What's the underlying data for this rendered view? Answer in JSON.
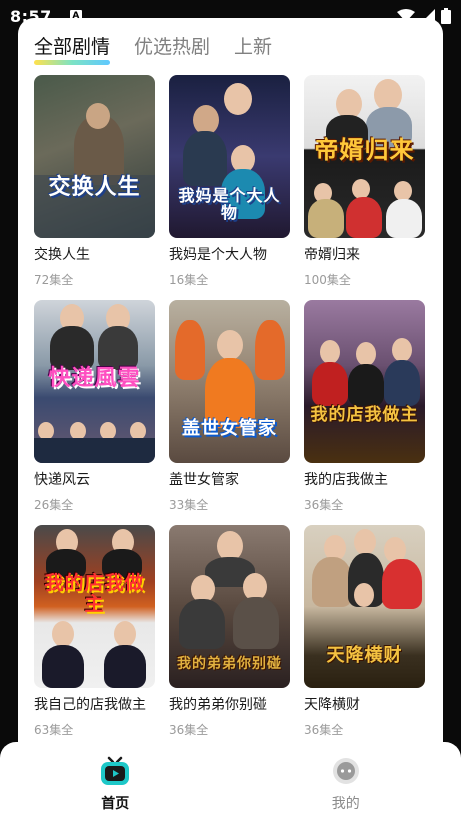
{
  "status_bar": {
    "time": "8:57",
    "notification_badge": "A",
    "icons": [
      "wifi-icon",
      "signal-icon",
      "battery-icon"
    ]
  },
  "tabs": [
    {
      "label": "全部剧情",
      "active": true
    },
    {
      "label": "优选热剧",
      "active": false
    },
    {
      "label": "上新",
      "active": false
    }
  ],
  "dramas": [
    {
      "title": "交换人生",
      "episodes": "72集全",
      "poster_text": "交换人生"
    },
    {
      "title": "我妈是个大人物",
      "episodes": "16集全",
      "poster_text": "我妈是个大人物"
    },
    {
      "title": "帝婿归来",
      "episodes": "100集全",
      "poster_text": "帝婿归来"
    },
    {
      "title": "快递风云",
      "episodes": "26集全",
      "poster_text": "快递風雲"
    },
    {
      "title": "盖世女管家",
      "episodes": "33集全",
      "poster_text": "盖世女管家"
    },
    {
      "title": "我的店我做主",
      "episodes": "36集全",
      "poster_text": "我的店我做主"
    },
    {
      "title": "我自己的店我做主",
      "episodes": "63集全",
      "poster_text": "我的店我做主"
    },
    {
      "title": "我的弟弟你别碰",
      "episodes": "36集全",
      "poster_text": "我的弟弟你别碰"
    },
    {
      "title": "天降横财",
      "episodes": "36集全",
      "poster_text": "天降横财"
    }
  ],
  "bottom_nav": [
    {
      "label": "首页",
      "icon": "tv-icon",
      "active": true
    },
    {
      "label": "我的",
      "icon": "chat-bubble-icon",
      "active": false
    }
  ],
  "colors": {
    "accent_tab_gradient": [
      "#ffe14d",
      "#7de3c4",
      "#5fc8ff"
    ],
    "home_icon": "#1ec8c8",
    "inactive_text": "#8a8a8a",
    "episodes_text": "#9a9a9a"
  }
}
